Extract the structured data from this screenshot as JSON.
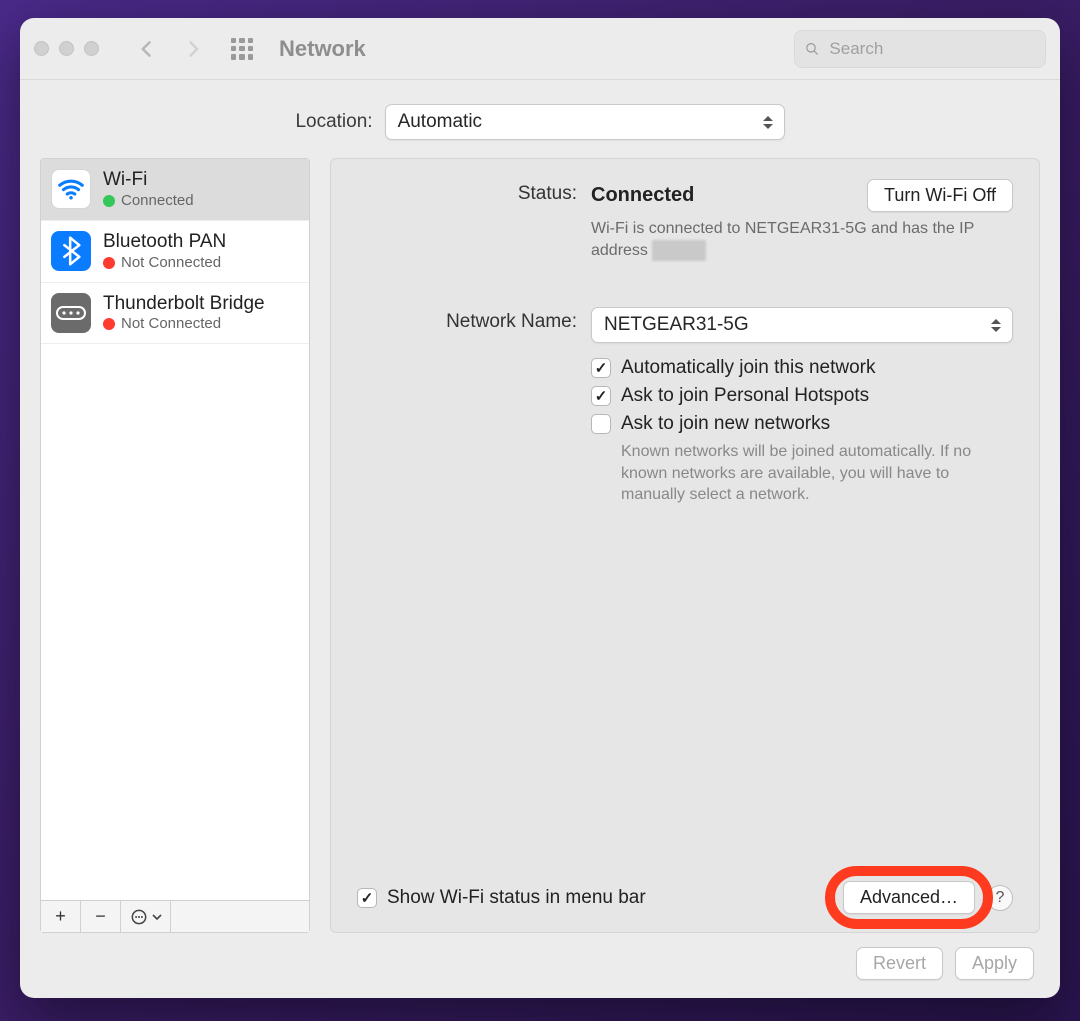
{
  "window": {
    "title": "Network"
  },
  "search": {
    "placeholder": "Search"
  },
  "location": {
    "label": "Location:",
    "value": "Automatic"
  },
  "interfaces": [
    {
      "name": "Wi-Fi",
      "status": "Connected",
      "dot": "green",
      "icon": "wifi",
      "selected": true
    },
    {
      "name": "Bluetooth PAN",
      "status": "Not Connected",
      "dot": "red",
      "icon": "bt",
      "selected": false
    },
    {
      "name": "Thunderbolt Bridge",
      "status": "Not Connected",
      "dot": "red",
      "icon": "tb",
      "selected": false
    }
  ],
  "detail": {
    "status_label": "Status:",
    "status_value": "Connected",
    "wifi_toggle": "Turn Wi-Fi Off",
    "status_desc_prefix": "Wi-Fi is connected to NETGEAR31-5G and has the IP address ",
    "status_desc_redacted": "▇▇▇▇",
    "network_name_label": "Network Name:",
    "network_name_value": "NETGEAR31-5G",
    "cb_auto_join": "Automatically join this network",
    "cb_ask_hotspot": "Ask to join Personal Hotspots",
    "cb_ask_new": "Ask to join new networks",
    "new_networks_hint": "Known networks will be joined automatically. If no known networks are available, you will have to manually select a network.",
    "show_status_label": "Show Wi-Fi status in menu bar",
    "advanced_button": "Advanced…",
    "help": "?"
  },
  "footer": {
    "revert": "Revert",
    "apply": "Apply"
  },
  "sidebar_buttons": {
    "plus": "+",
    "minus": "−",
    "more": "⊙"
  }
}
